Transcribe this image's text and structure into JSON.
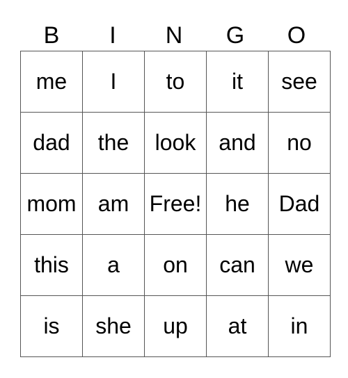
{
  "header": [
    "B",
    "I",
    "N",
    "G",
    "O"
  ],
  "rows": [
    [
      "me",
      "I",
      "to",
      "it",
      "see"
    ],
    [
      "dad",
      "the",
      "look",
      "and",
      "no"
    ],
    [
      "mom",
      "am",
      "Free!",
      "he",
      "Dad"
    ],
    [
      "this",
      "a",
      "on",
      "can",
      "we"
    ],
    [
      "is",
      "she",
      "up",
      "at",
      "in"
    ]
  ]
}
